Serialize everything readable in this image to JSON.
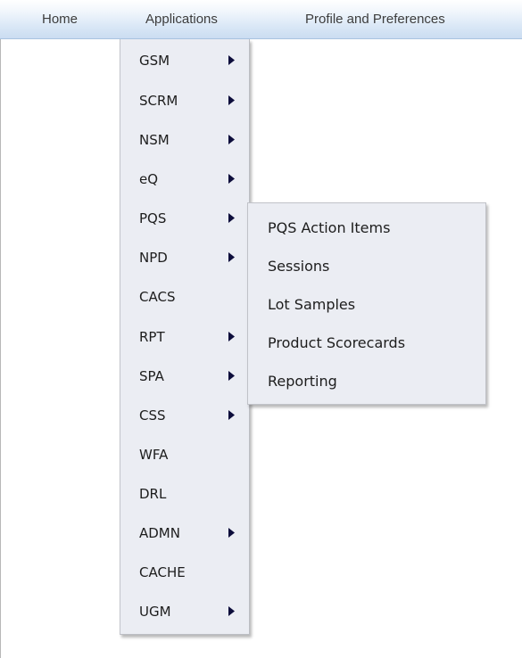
{
  "menubar": {
    "home": "Home",
    "applications": "Applications",
    "profile": "Profile and Preferences"
  },
  "applications_menu": {
    "items": [
      {
        "label": "GSM",
        "has_submenu": true
      },
      {
        "label": "SCRM",
        "has_submenu": true
      },
      {
        "label": "NSM",
        "has_submenu": true
      },
      {
        "label": "eQ",
        "has_submenu": true
      },
      {
        "label": "PQS",
        "has_submenu": true
      },
      {
        "label": "NPD",
        "has_submenu": true
      },
      {
        "label": "CACS",
        "has_submenu": false
      },
      {
        "label": "RPT",
        "has_submenu": true
      },
      {
        "label": "SPA",
        "has_submenu": true
      },
      {
        "label": "CSS",
        "has_submenu": true
      },
      {
        "label": "WFA",
        "has_submenu": false
      },
      {
        "label": "DRL",
        "has_submenu": false
      },
      {
        "label": "ADMN",
        "has_submenu": true
      },
      {
        "label": "CACHE",
        "has_submenu": false
      },
      {
        "label": "UGM",
        "has_submenu": true
      }
    ]
  },
  "pqs_submenu": {
    "items": [
      {
        "label": "PQS Action Items"
      },
      {
        "label": "Sessions"
      },
      {
        "label": "Lot Samples"
      },
      {
        "label": "Product Scorecards"
      },
      {
        "label": "Reporting"
      }
    ]
  },
  "icons": {
    "submenu_arrow": "triangle-right-icon"
  },
  "colors": {
    "menubar_top": "#ffffff",
    "menubar_bottom": "#cadcf1",
    "menu_background": "#ebedf3",
    "arrow": "#0d0d3b",
    "text": "#1d1d1d"
  }
}
